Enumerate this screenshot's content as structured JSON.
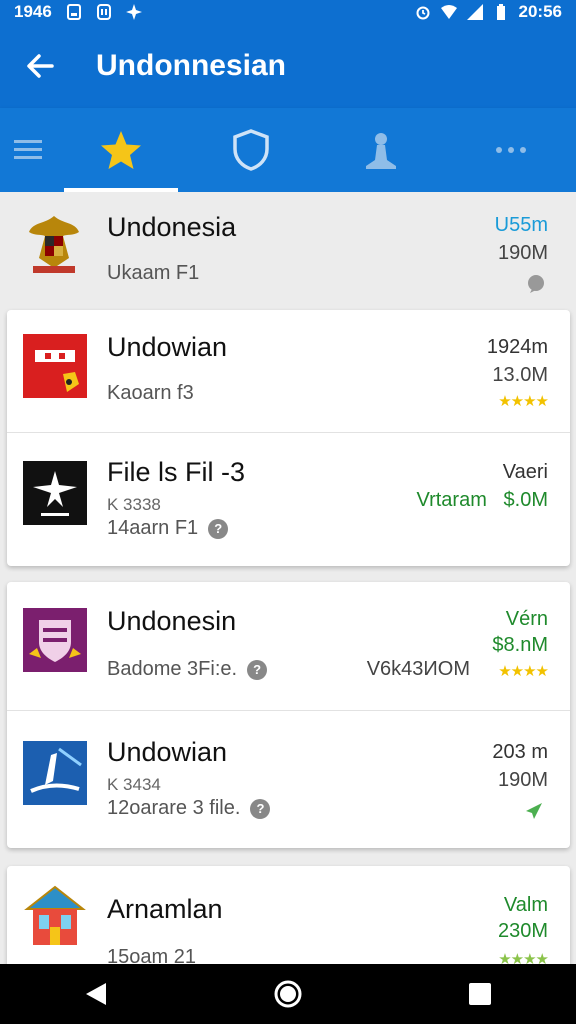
{
  "status_bar": {
    "time_left": "1946",
    "time_right": "20:56"
  },
  "app_bar": {
    "title": "Undonnesian"
  },
  "tabs": [
    {
      "icon": "menu-icon"
    },
    {
      "icon": "star-icon"
    },
    {
      "icon": "shield-icon"
    },
    {
      "icon": "person-icon"
    },
    {
      "icon": "more-icon"
    }
  ],
  "items": [
    {
      "title": "Undonesia",
      "subtitle": "Ukaam F1",
      "right_top": "U55m",
      "right_mid": "190M",
      "colors": {
        "right_top": "#1a9bd8"
      }
    },
    {
      "title": "Undowian",
      "subtitle": "Kaoarn f3",
      "right_top": "1924m",
      "right_mid": "13.0M",
      "rating": "★★★★"
    },
    {
      "title": "File ls Fil -3",
      "line2": "K 3338",
      "subtitle": "14aarn F1",
      "right_top": "Vaeri",
      "right_mid_label": "Vrtaram",
      "right_mid": "$.0M"
    },
    {
      "title": "Undonesin",
      "subtitle": "Badome 3Fi:e.",
      "right_top": "Vérn",
      "right_mid": "$8.nM",
      "right_side": "V6k43ИОМ",
      "rating": "★★★★"
    },
    {
      "title": "Undowian",
      "line2": "K 3434",
      "subtitle": "12oarare 3 file.",
      "right_top": "203 m",
      "right_mid": "190M"
    },
    {
      "title": "Arnamlan",
      "subtitle": "15oam 21",
      "right_top": "Valm",
      "right_mid": "230M",
      "rating": "★★★★"
    }
  ],
  "colors": {
    "primary": "#0d6fd0",
    "tab_bg": "#1278d6",
    "green": "#1f8a2c",
    "star": "#f2c200"
  }
}
